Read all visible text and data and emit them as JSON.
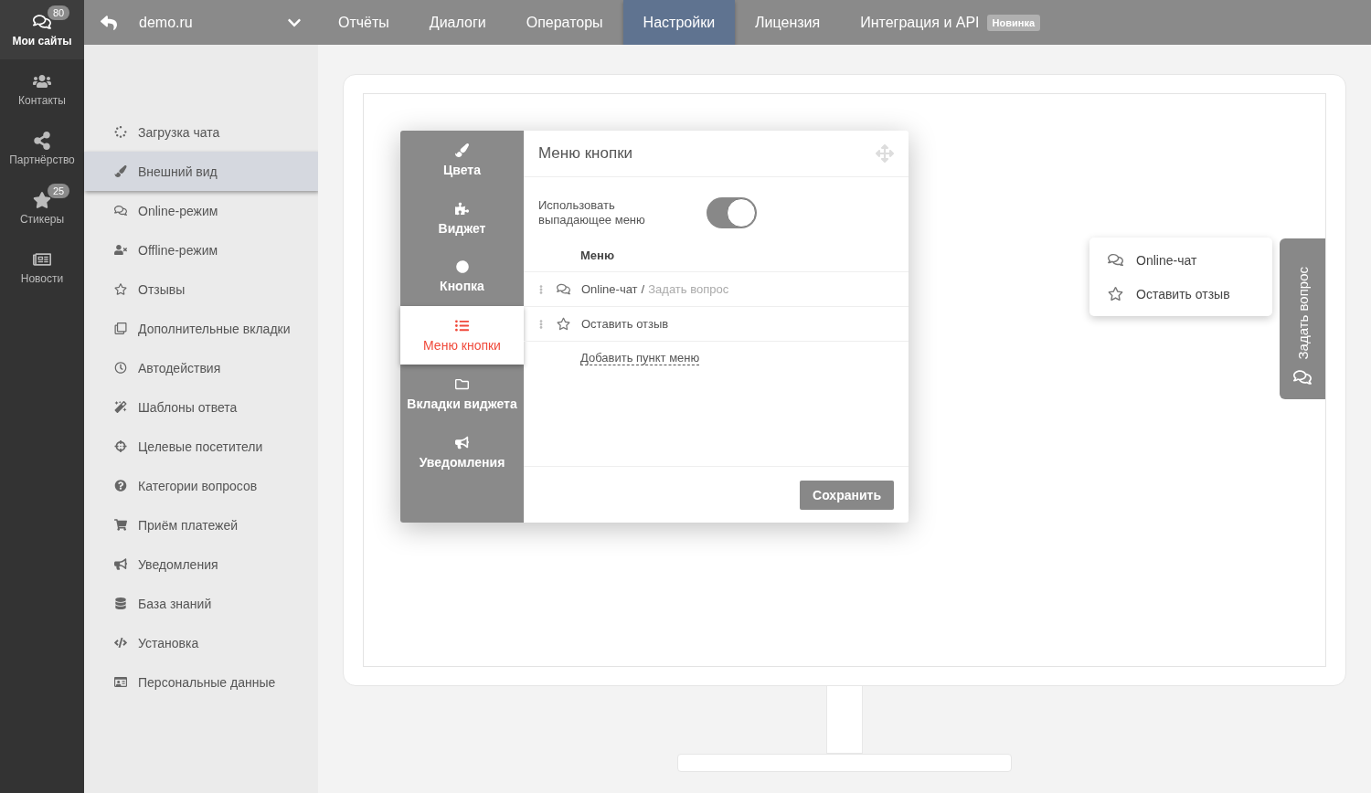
{
  "rail": [
    {
      "label": "Мои сайты",
      "badge": "80",
      "selected": true
    },
    {
      "label": "Контакты",
      "selected": false
    },
    {
      "label": "Партнёрство",
      "selected": false
    },
    {
      "label": "Стикеры",
      "badge": "25",
      "selected": false
    },
    {
      "label": "Новости",
      "selected": false
    }
  ],
  "topbar": {
    "site": "demo.ru",
    "nav": [
      {
        "label": "Отчёты",
        "selected": false
      },
      {
        "label": "Диалоги",
        "selected": false
      },
      {
        "label": "Операторы",
        "selected": false
      },
      {
        "label": "Настройки",
        "selected": true
      },
      {
        "label": "Лицензия",
        "selected": false
      },
      {
        "label": "Интеграция и API",
        "badge": "Новинка",
        "selected": false
      }
    ]
  },
  "settings_menu": [
    {
      "label": "Загрузка чата",
      "selected": false
    },
    {
      "label": "Внешний вид",
      "selected": true
    },
    {
      "label": "Online-режим",
      "selected": false
    },
    {
      "label": "Offline-режим",
      "selected": false
    },
    {
      "label": "Отзывы",
      "selected": false
    },
    {
      "label": "Дополнительные вкладки",
      "selected": false
    },
    {
      "label": "Автодействия",
      "selected": false
    },
    {
      "label": "Шаблоны ответа",
      "selected": false
    },
    {
      "label": "Целевые посетители",
      "selected": false
    },
    {
      "label": "Категории вопросов",
      "selected": false
    },
    {
      "label": "Приём платежей",
      "selected": false
    },
    {
      "label": "Уведомления",
      "selected": false
    },
    {
      "label": "База знаний",
      "selected": false
    },
    {
      "label": "Установка",
      "selected": false
    },
    {
      "label": "Персональные данные",
      "selected": false
    }
  ],
  "dialog": {
    "tabs": [
      {
        "label": "Цвета",
        "selected": false
      },
      {
        "label": "Виджет",
        "selected": false
      },
      {
        "label": "Кнопка",
        "selected": false
      },
      {
        "label": "Меню кнопки",
        "selected": true
      },
      {
        "label": "Вкладки виджета",
        "selected": false
      },
      {
        "label": "Уведомления",
        "selected": false
      }
    ],
    "title": "Меню кнопки",
    "toggle": {
      "label": "Использовать выпадающее меню",
      "on": true
    },
    "menu_heading": "Меню",
    "items": [
      {
        "label": "Online-чат",
        "separator": "/",
        "hint": "Задать вопрос"
      },
      {
        "label": "Оставить отзыв"
      }
    ],
    "add_link": "Добавить пункт меню",
    "save": "Сохранить"
  },
  "preview": {
    "popup": [
      "Online-чат",
      "Оставить отзыв"
    ],
    "side_tab": "Задать вопрос"
  }
}
